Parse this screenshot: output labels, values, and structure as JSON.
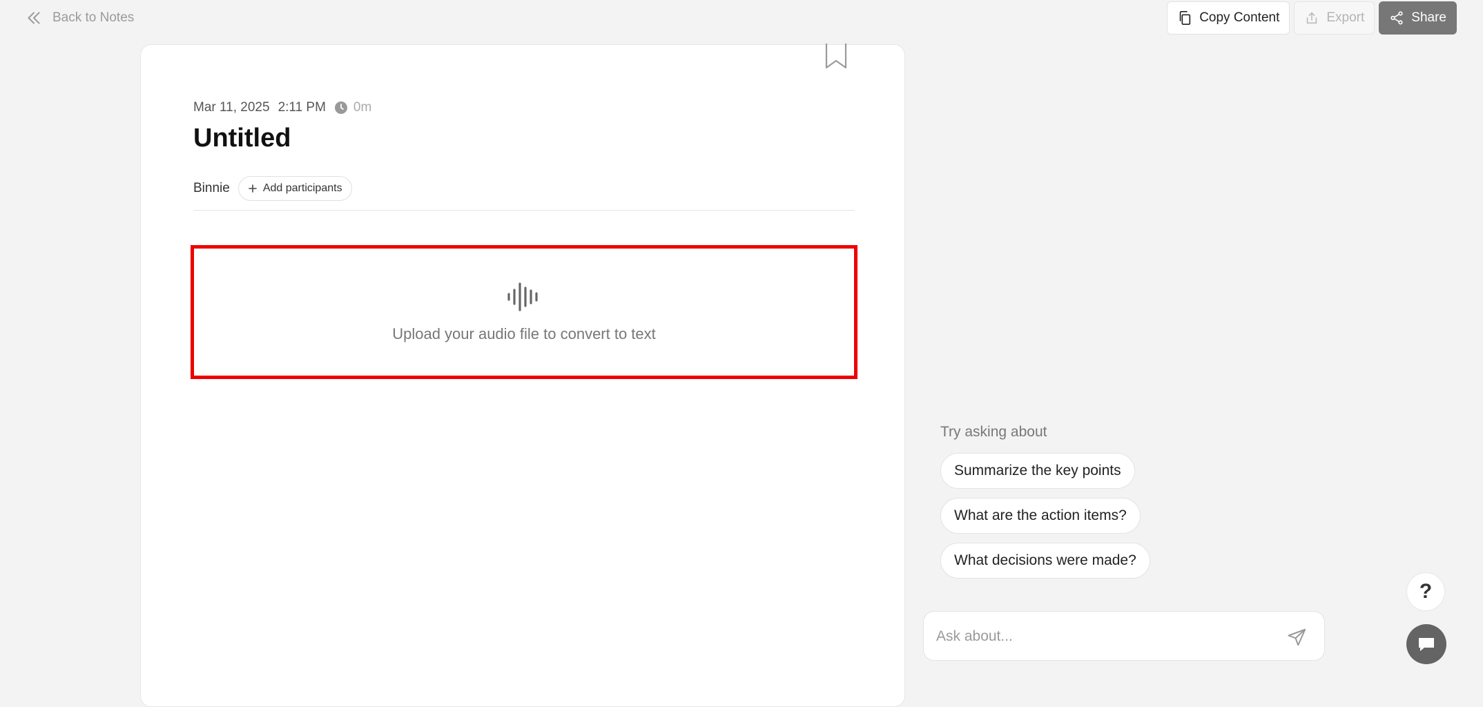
{
  "header": {
    "back_label": "Back to Notes",
    "copy_label": "Copy Content",
    "export_label": "Export",
    "share_label": "Share"
  },
  "note": {
    "date": "Mar 11, 2025",
    "time": "2:11 PM",
    "duration": "0m",
    "title": "Untitled",
    "participant": "Binnie",
    "add_participants_label": "Add participants",
    "upload_text": "Upload your audio file to convert to text"
  },
  "assistant": {
    "suggest_title": "Try asking about",
    "suggestions": [
      "Summarize the key points",
      "What are the action items?",
      "What decisions were made?"
    ],
    "placeholder": "Ask about..."
  },
  "help": {
    "label": "?"
  },
  "colors": {
    "highlight": "#ee0000",
    "share_bg": "#777777",
    "page_bg": "#f3f3f3"
  },
  "icons": [
    "double-chevron-left-icon",
    "copy-icon",
    "export-icon",
    "share-icon",
    "bookmark-icon",
    "clock-icon",
    "plus-icon",
    "audio-wave-icon",
    "send-icon",
    "chat-icon"
  ]
}
